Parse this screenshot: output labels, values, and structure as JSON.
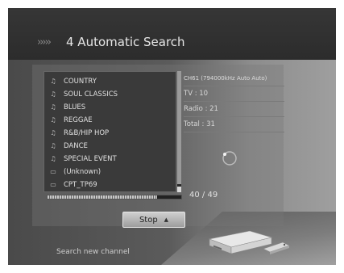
{
  "header": {
    "arrows": "›››››",
    "title": "4 Automatic Search"
  },
  "genre_list": [
    {
      "label": "COUNTRY",
      "icon": "music-note-icon",
      "glyph": "♫"
    },
    {
      "label": "SOUL CLASSICS",
      "icon": "music-note-icon",
      "glyph": "♫"
    },
    {
      "label": "BLUES",
      "icon": "music-note-icon",
      "glyph": "♫"
    },
    {
      "label": "REGGAE",
      "icon": "music-note-icon",
      "glyph": "♫"
    },
    {
      "label": "R&B/HIP HOP",
      "icon": "music-note-icon",
      "glyph": "♫"
    },
    {
      "label": "DANCE",
      "icon": "music-note-icon",
      "glyph": "♫"
    },
    {
      "label": "SPECIAL EVENT",
      "icon": "music-note-icon",
      "glyph": "♫"
    },
    {
      "label": "(Unknown)",
      "icon": "tv-icon",
      "glyph": "▭"
    },
    {
      "label": "CPT_TP69",
      "icon": "tv-icon",
      "glyph": "▭"
    }
  ],
  "info": {
    "channel": "CH61 (794000kHz Auto Auto)",
    "tv": "TV : 10",
    "radio": "Radio : 21",
    "total": "Total : 31"
  },
  "progress": {
    "text": "40 / 49",
    "current": 40,
    "total": 49
  },
  "stop_button": {
    "label": "Stop",
    "icon": "remote-button-icon",
    "glyph": "▲"
  },
  "footer": {
    "hint": "Search new channel"
  }
}
